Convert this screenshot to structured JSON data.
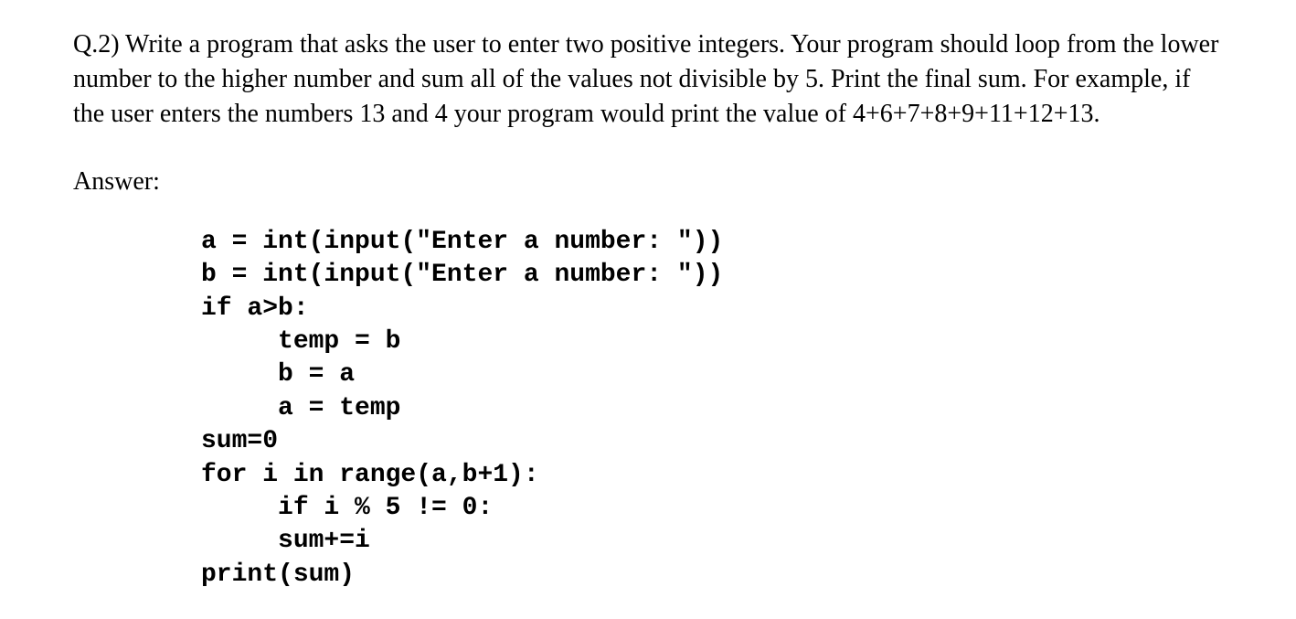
{
  "question": {
    "text": "Q.2) Write a program that asks the user to enter two positive integers. Your program should loop from the lower number to the higher number and sum all of the values not divisible by 5. Print the final sum. For example, if the user enters the numbers 13 and 4 your program would print the value of  4+6+7+8+9+11+12+13."
  },
  "answer": {
    "label": "Answer:",
    "code_lines": [
      "a = int(input(\"Enter a number: \"))",
      "b = int(input(\"Enter a number: \"))",
      "if a>b:",
      "     temp = b",
      "     b = a",
      "     a = temp",
      "sum=0",
      "for i in range(a,b+1):",
      "     if i % 5 != 0:",
      "     sum+=i",
      "print(sum)"
    ]
  }
}
